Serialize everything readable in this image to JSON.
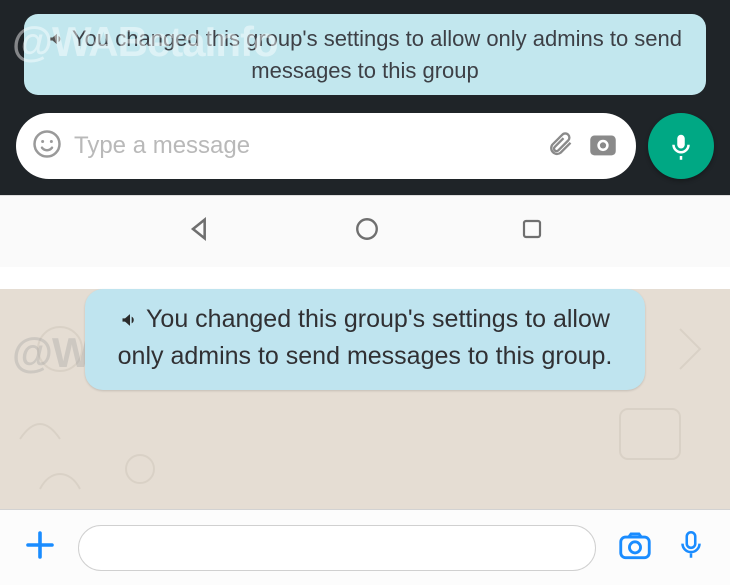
{
  "watermark": "@WABetaInfo",
  "top": {
    "system_message": "You changed this group's settings to allow only admins to send messages to this group",
    "input_placeholder": "Type a message"
  },
  "bottom": {
    "system_message": "You changed this group's settings to allow only admins to send messages to this group."
  }
}
